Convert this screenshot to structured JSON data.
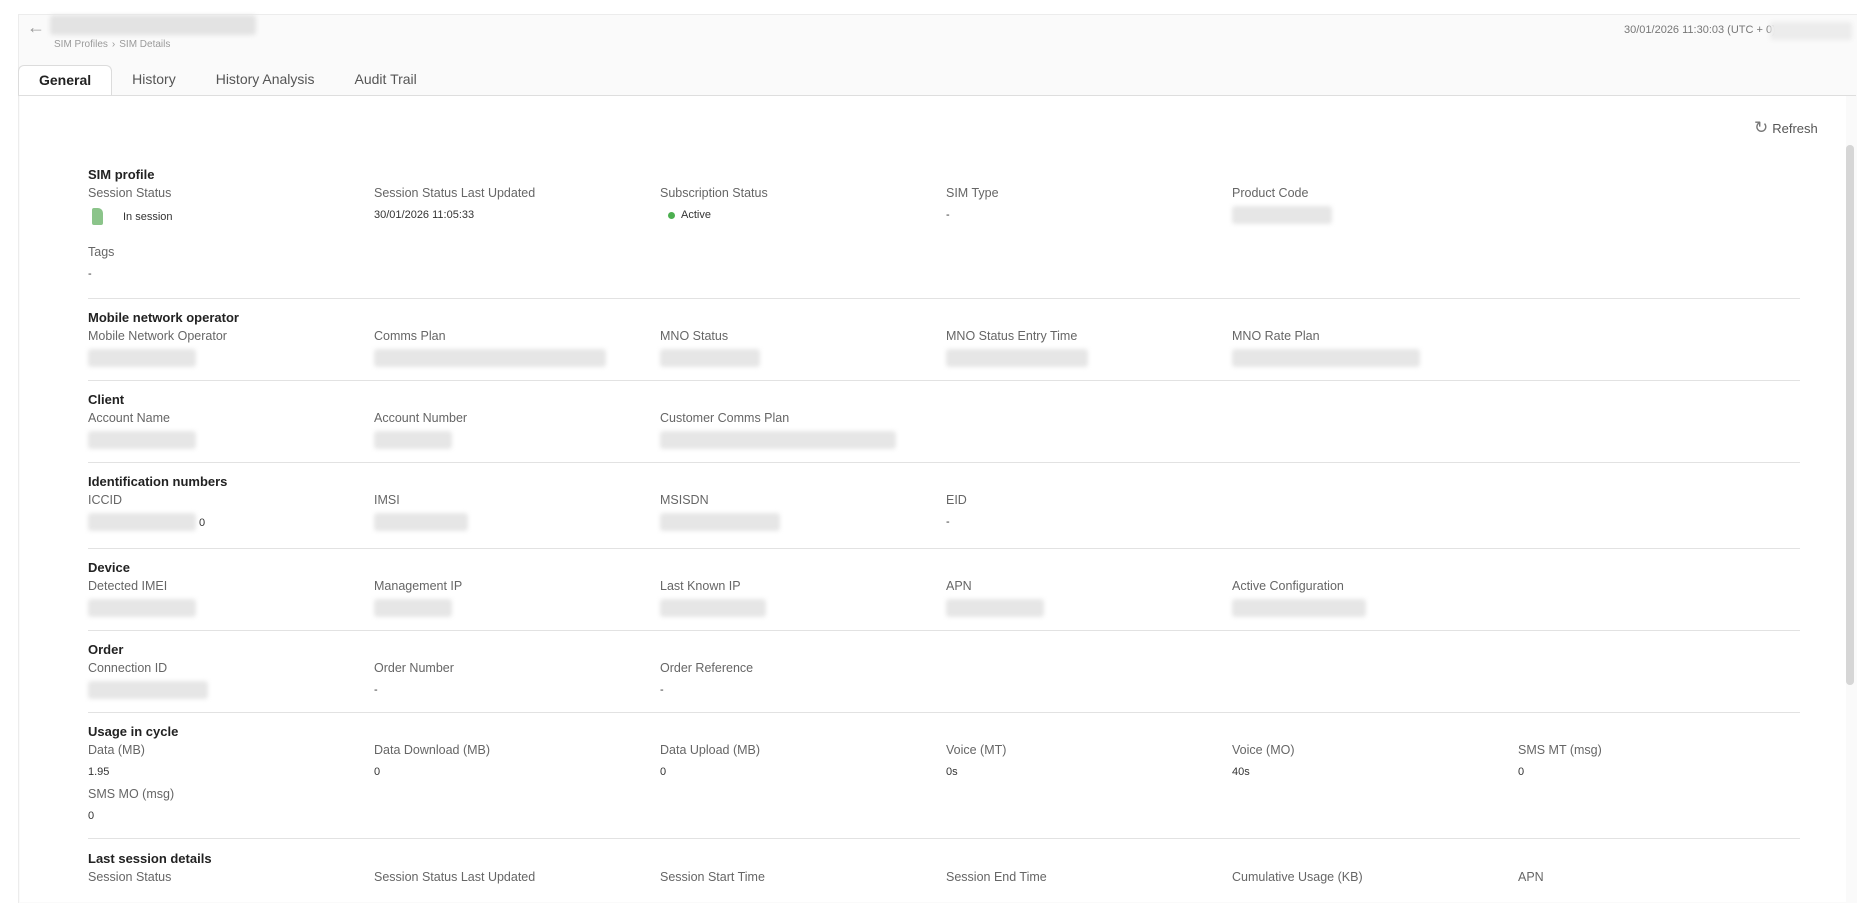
{
  "header": {
    "breadcrumb": [
      "SIM Profiles",
      "SIM Details"
    ],
    "breadcrumb_sep": "›",
    "timestamp": "30/01/2026 11:30:03 (UTC + 0)"
  },
  "tabs": [
    {
      "label": "General",
      "active": true
    },
    {
      "label": "History"
    },
    {
      "label": "History Analysis"
    },
    {
      "label": "Audit Trail"
    }
  ],
  "toolbar": {
    "refresh_label": "Refresh"
  },
  "colors": {
    "accent": "#4caf50",
    "sim_icon": "#8bc48a"
  },
  "sections": {
    "sim_profile": {
      "title": "SIM profile",
      "session_status": {
        "label": "Session Status",
        "value": "In session"
      },
      "session_status_last_updated": {
        "label": "Session Status Last Updated",
        "value": "30/01/2026 11:05:33"
      },
      "subscription_status": {
        "label": "Subscription Status",
        "value": "Active"
      },
      "sim_type": {
        "label": "SIM Type",
        "value": "-"
      },
      "product_code": {
        "label": "Product Code"
      },
      "tags": {
        "label": "Tags",
        "value": "-"
      }
    },
    "mno": {
      "title": "Mobile network operator",
      "operator": {
        "label": "Mobile Network Operator"
      },
      "comms_plan": {
        "label": "Comms Plan"
      },
      "status": {
        "label": "MNO Status"
      },
      "status_entry_time": {
        "label": "MNO Status Entry Time"
      },
      "rate_plan": {
        "label": "MNO Rate Plan"
      }
    },
    "client": {
      "title": "Client",
      "account_name": {
        "label": "Account Name"
      },
      "account_number": {
        "label": "Account Number"
      },
      "customer_comms_plan": {
        "label": "Customer Comms Plan"
      }
    },
    "identification": {
      "title": "Identification numbers",
      "iccid": {
        "label": "ICCID",
        "tail": "0"
      },
      "imsi": {
        "label": "IMSI"
      },
      "msisdn": {
        "label": "MSISDN"
      },
      "eid": {
        "label": "EID",
        "value": "-"
      }
    },
    "device": {
      "title": "Device",
      "detected_imei": {
        "label": "Detected IMEI"
      },
      "management_ip": {
        "label": "Management IP"
      },
      "last_known_ip": {
        "label": "Last Known IP"
      },
      "apn": {
        "label": "APN"
      },
      "active_configuration": {
        "label": "Active Configuration"
      }
    },
    "order": {
      "title": "Order",
      "connection_id": {
        "label": "Connection ID"
      },
      "order_number": {
        "label": "Order Number",
        "value": "-"
      },
      "order_reference": {
        "label": "Order Reference",
        "value": "-"
      }
    },
    "usage": {
      "title": "Usage in cycle",
      "data": {
        "label": "Data (MB)",
        "value": "1.95"
      },
      "data_download": {
        "label": "Data Download (MB)",
        "value": "0"
      },
      "data_upload": {
        "label": "Data Upload (MB)",
        "value": "0"
      },
      "voice_mt": {
        "label": "Voice (MT)",
        "value": "0s"
      },
      "voice_mo": {
        "label": "Voice (MO)",
        "value": "40s"
      },
      "sms_mt": {
        "label": "SMS MT (msg)",
        "value": "0"
      },
      "sms_mo": {
        "label": "SMS MO (msg)",
        "value": "0"
      }
    },
    "last_session": {
      "title": "Last session details",
      "session_status": {
        "label": "Session Status"
      },
      "session_status_last_updated": {
        "label": "Session Status Last Updated"
      },
      "session_start_time": {
        "label": "Session Start Time"
      },
      "session_end_time": {
        "label": "Session End Time"
      },
      "cumulative_usage": {
        "label": "Cumulative Usage (KB)"
      },
      "apn": {
        "label": "APN"
      }
    }
  }
}
